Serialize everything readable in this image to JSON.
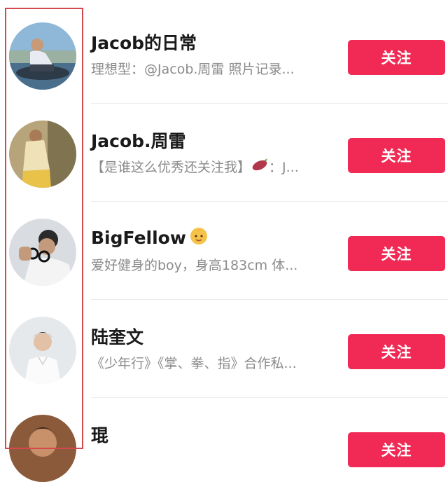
{
  "accounts": [
    {
      "name": "Jacob的日常",
      "bio": "理想型：@Jacob.周雷 照片记录...",
      "follow_label": "关注",
      "avatar": "avatar-man-on-boat"
    },
    {
      "name": "Jacob.周雷",
      "bio_before": "【是谁这么优秀还关注我】",
      "bio_icon": "sweet-potato-icon",
      "bio_after": "：J...",
      "follow_label": "关注",
      "avatar": "avatar-man-sunlight"
    },
    {
      "name": "BigFellow",
      "name_icon": "baby-face-emoji",
      "bio": "爱好健身的boy，身高183cm 体...",
      "follow_label": "关注",
      "avatar": "avatar-man-with-glasses"
    },
    {
      "name": "陆奎文",
      "bio": "《少年行》《掌、拳、指》合作私...",
      "follow_label": "关注",
      "avatar": "avatar-man-white-shirt"
    },
    {
      "name": "琨",
      "follow_label": "关注",
      "avatar": "avatar-partial"
    }
  ],
  "colors": {
    "follow_button": "#f02a55",
    "highlight_border": "#d6484d"
  }
}
